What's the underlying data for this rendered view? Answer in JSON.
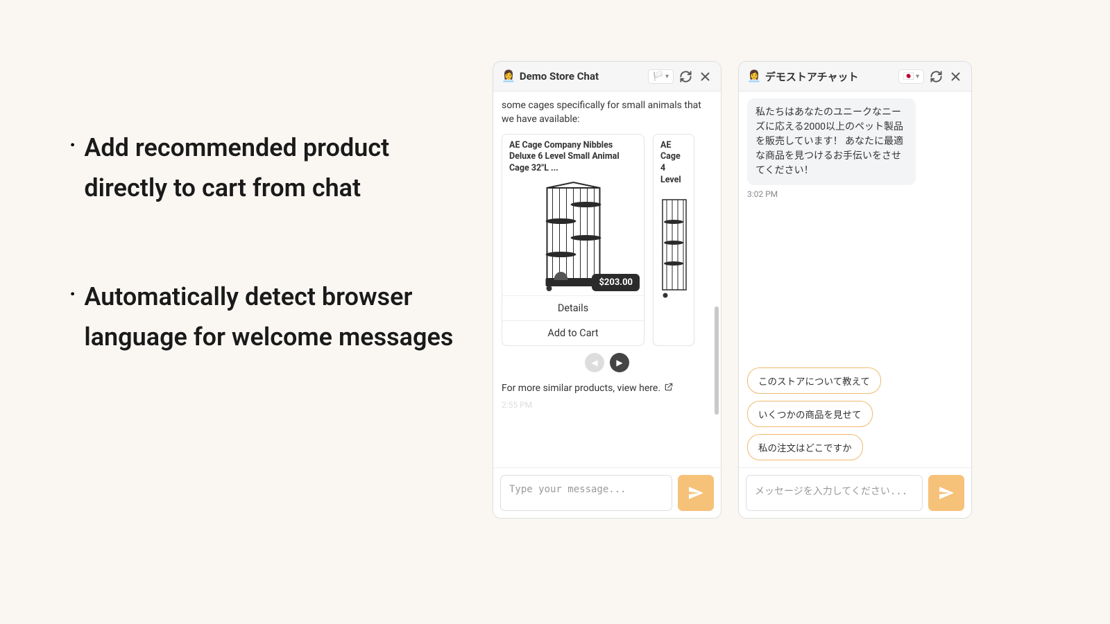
{
  "bullets": [
    "Add recommended product directly to cart from chat",
    "Automatically detect browser language for welcome messages"
  ],
  "chat_en": {
    "title": "Demo Store Chat",
    "flag": "🏳️",
    "intro": "some cages specifically for small animals that we have available:",
    "products": [
      {
        "title": "AE Cage Company Nibbles Deluxe 6 Level Small Animal Cage 32\"L ...",
        "price": "$203.00",
        "details_label": "Details",
        "add_label": "Add to Cart"
      },
      {
        "title": "AE Cage 4 Level"
      }
    ],
    "footer": "For more similar products, view here.",
    "partial_ts": "2:55 PM",
    "placeholder": "Type your message..."
  },
  "chat_ja": {
    "title": "デモストアチャット",
    "flag": "🇯🇵",
    "message": "私たちはあなたのユニークなニーズに応える2000以上のペット製品を販売しています！ あなたに最適な商品を見つけるお手伝いをさせてください！",
    "timestamp": "3:02 PM",
    "quick_replies": [
      "このストアについて教えて",
      "いくつかの商品を見せて",
      "私の注文はどこですか"
    ],
    "placeholder": "メッセージを入力してください..."
  }
}
